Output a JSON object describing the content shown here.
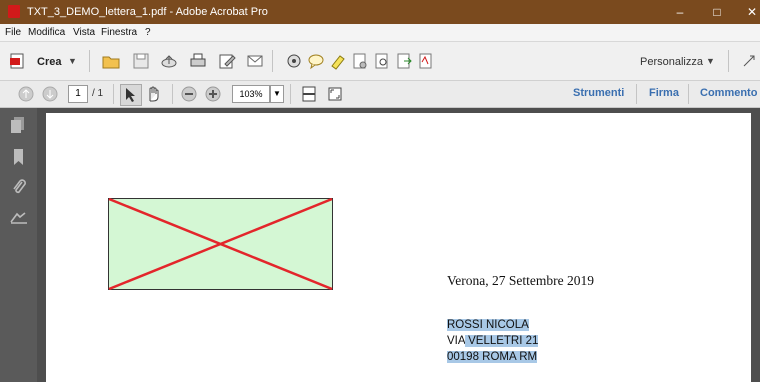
{
  "window": {
    "title": "TXT_3_DEMO_lettera_1.pdf - Adobe Acrobat Pro",
    "minimize": "–",
    "maximize": "□",
    "close": "✕"
  },
  "menu": {
    "file": "File",
    "modifica": "Modifica",
    "vista": "Vista",
    "finestra": "Finestra",
    "help": "?"
  },
  "toolbar": {
    "crea_label": "Crea",
    "personalizza_label": "Personalizza"
  },
  "nav": {
    "page_current": "1",
    "page_total": "/ 1",
    "zoom": "103%",
    "strumenti": "Strumenti",
    "firma": "Firma",
    "commento": "Commento"
  },
  "document": {
    "date_line": "Verona, 27 Settembre 2019",
    "address": {
      "name": "ROSSI NICOLA",
      "street_prefix": "VIA",
      "street_rest": " VELLETRI 21",
      "city": "00198 ROMA RM"
    }
  },
  "colors": {
    "titlebar": "#7a4a1e",
    "placeholder_fill": "#d4f7d4",
    "placeholder_x": "#e3262b",
    "selection": "#a8c8e6",
    "link_blue": "#3a6fb0"
  },
  "icons": [
    "app-icon",
    "crea-icon",
    "open-folder-icon",
    "save-icon",
    "upload-icon",
    "print-icon",
    "edit-icon",
    "email-icon",
    "gear-icon",
    "comment-icon",
    "highlight-icon",
    "redact-icon",
    "scan-icon",
    "export-icon",
    "sign-icon",
    "prev-page-icon",
    "next-page-icon",
    "select-arrow-icon",
    "hand-icon",
    "zoom-out-icon",
    "zoom-in-icon",
    "fit-page-icon",
    "fullscreen-icon",
    "pages-panel-icon",
    "bookmarks-panel-icon",
    "attachments-panel-icon",
    "signatures-panel-icon"
  ]
}
